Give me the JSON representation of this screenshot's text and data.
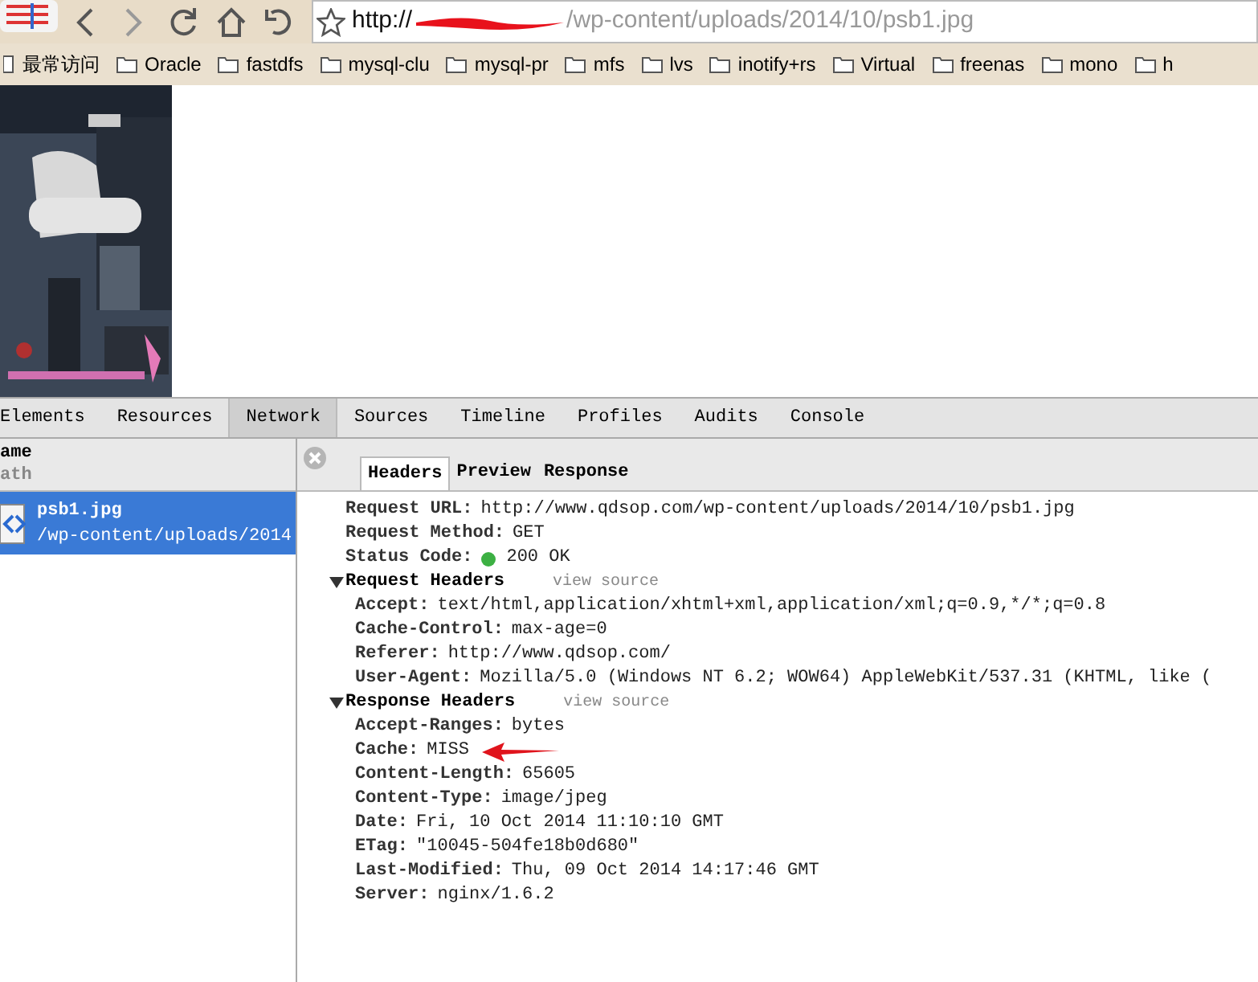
{
  "address_bar": {
    "scheme": "http://",
    "path": "/wp-content/uploads/2014/10/psb1.jpg"
  },
  "bookmarks": [
    {
      "label": "最常访问",
      "kind": "plain"
    },
    {
      "label": "Oracle",
      "kind": "folder"
    },
    {
      "label": "fastdfs",
      "kind": "folder"
    },
    {
      "label": "mysql-clu",
      "kind": "folder"
    },
    {
      "label": "mysql-pr",
      "kind": "folder"
    },
    {
      "label": "mfs",
      "kind": "folder"
    },
    {
      "label": "lvs",
      "kind": "folder"
    },
    {
      "label": "inotify+rs",
      "kind": "folder"
    },
    {
      "label": "Virtual",
      "kind": "folder"
    },
    {
      "label": "freenas",
      "kind": "folder"
    },
    {
      "label": "mono",
      "kind": "folder"
    },
    {
      "label": "h",
      "kind": "folder"
    }
  ],
  "devtools": {
    "tabs": [
      {
        "label": "Elements",
        "selected": false
      },
      {
        "label": "Resources",
        "selected": false
      },
      {
        "label": "Network",
        "selected": true
      },
      {
        "label": "Sources",
        "selected": false
      },
      {
        "label": "Timeline",
        "selected": false
      },
      {
        "label": "Profiles",
        "selected": false
      },
      {
        "label": "Audits",
        "selected": false
      },
      {
        "label": "Console",
        "selected": false
      }
    ],
    "list_header": {
      "name": "ame",
      "path": "ath"
    },
    "requests": [
      {
        "name": "psb1.jpg",
        "path": "/wp-content/uploads/2014",
        "selected": true
      }
    ],
    "detail_tabs": [
      {
        "label": "Headers",
        "selected": true
      },
      {
        "label": "Preview",
        "selected": false
      },
      {
        "label": "Response",
        "selected": false
      }
    ],
    "general": [
      {
        "name": "Request URL:",
        "value": "http://www.qdsop.com/wp-content/uploads/2014/10/psb1.jpg",
        "kind": "text"
      },
      {
        "name": "Request Method:",
        "value": "GET",
        "kind": "text"
      },
      {
        "name": "Status Code:",
        "value": "200 OK",
        "kind": "status"
      }
    ],
    "sections": [
      {
        "title": "Request Headers",
        "link": "view source",
        "expanded": true,
        "headers": [
          {
            "name": "Accept:",
            "value": "text/html,application/xhtml+xml,application/xml;q=0.9,*/*;q=0.8",
            "kind": "text"
          },
          {
            "name": "Cache-Control:",
            "value": "max-age=0",
            "kind": "text"
          },
          {
            "name": "Referer:",
            "value": "http://www.qdsop.com/",
            "kind": "text"
          },
          {
            "name": "User-Agent:",
            "value": "Mozilla/5.0 (Windows NT 6.2; WOW64) AppleWebKit/537.31 (KHTML, like (",
            "kind": "text"
          }
        ]
      },
      {
        "title": "Response Headers",
        "link": "view source",
        "expanded": true,
        "headers": [
          {
            "name": "Accept-Ranges:",
            "value": "bytes",
            "kind": "text"
          },
          {
            "name": "Cache:",
            "value": "MISS",
            "kind": "arrow"
          },
          {
            "name": "Content-Length:",
            "value": "65605",
            "kind": "text"
          },
          {
            "name": "Content-Type:",
            "value": "image/jpeg",
            "kind": "text"
          },
          {
            "name": "Date:",
            "value": "Fri, 10 Oct 2014 11:10:10 GMT",
            "kind": "text"
          },
          {
            "name": "ETag:",
            "value": "\"10045-504fe18b0d680\"",
            "kind": "text"
          },
          {
            "name": "Last-Modified:",
            "value": "Thu, 09 Oct 2014 14:17:46 GMT",
            "kind": "text"
          },
          {
            "name": "Server:",
            "value": "nginx/1.6.2",
            "kind": "text"
          }
        ]
      }
    ]
  }
}
